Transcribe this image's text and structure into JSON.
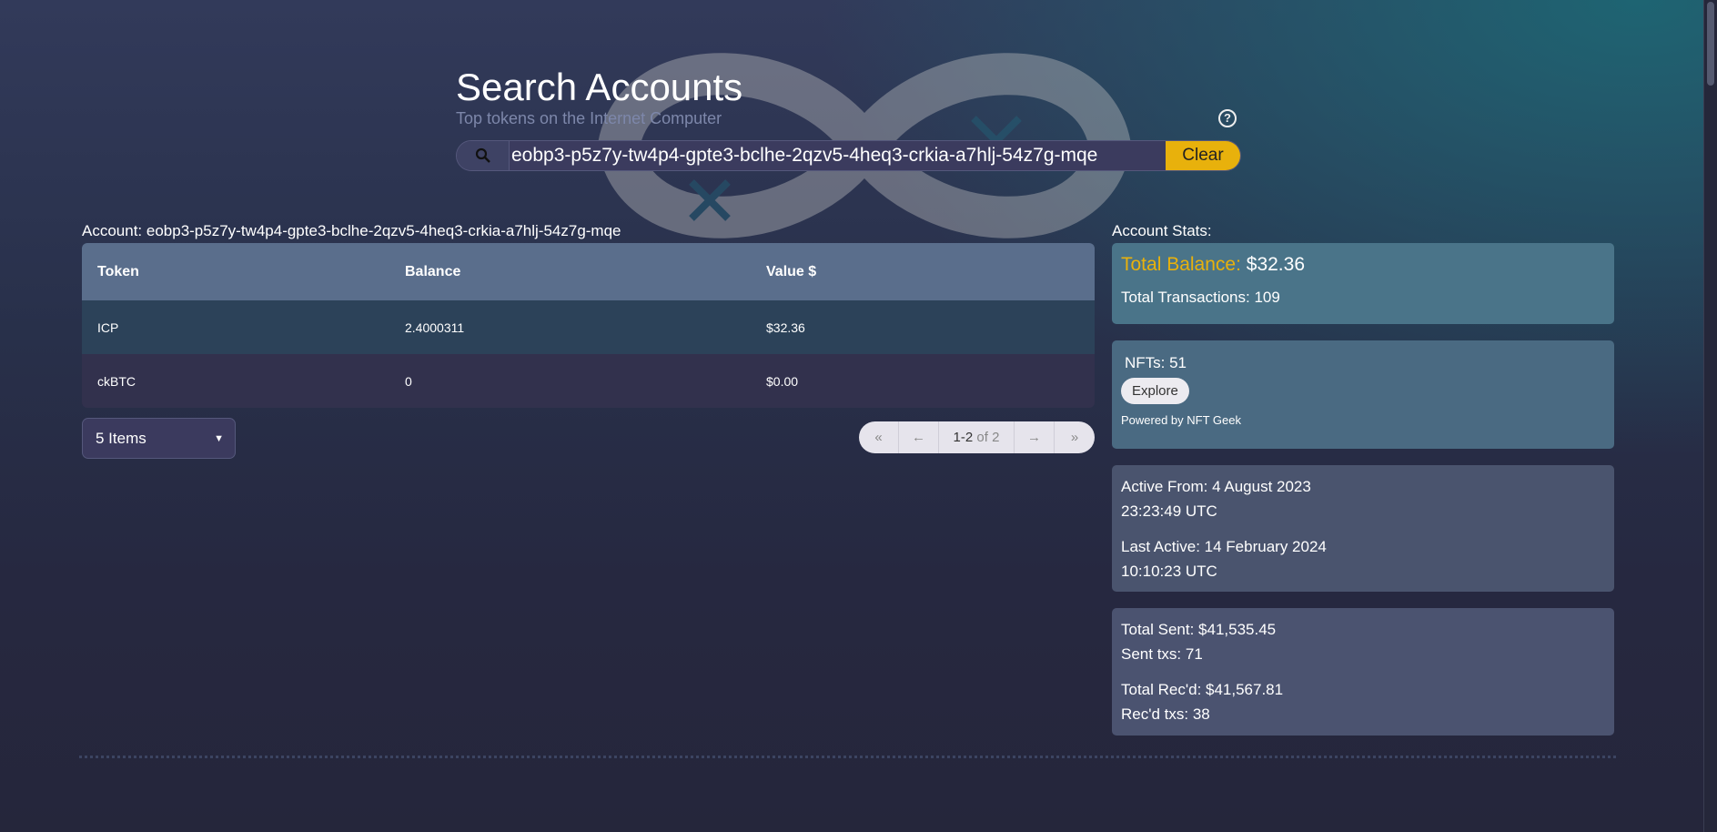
{
  "header": {
    "title": "Search Accounts",
    "subtitle": "Top tokens on the Internet Computer",
    "help_icon": "question-circle-icon"
  },
  "search": {
    "value": "eobp3-p5z7y-tw4p4-gpte3-bclhe-2qzv5-4heq3-crkia-a7hlj-54z7g-mqe",
    "clear_label": "Clear",
    "icon": "search-icon"
  },
  "account": {
    "label": "Account: eobp3-p5z7y-tw4p4-gpte3-bclhe-2qzv5-4heq3-crkia-a7hlj-54z7g-mqe"
  },
  "table": {
    "columns": [
      "Token",
      "Balance",
      "Value $"
    ],
    "rows": [
      [
        "ICP",
        "2.4000311",
        "$32.36"
      ],
      [
        "ckBTC",
        "0",
        "$0.00"
      ]
    ]
  },
  "page_size": {
    "selected": "5 Items"
  },
  "pagination": {
    "range": "1-2",
    "of": "of 2"
  },
  "stats": {
    "label": "Account Stats:",
    "total_balance_key": "Total Balance:",
    "total_balance_value": "$32.36",
    "total_transactions": "Total Transactions: 109",
    "nfts": "NFTs: 51",
    "explore_label": "Explore",
    "powered_by": "Powered by NFT Geek",
    "active_from": "Active From: 4 August 2023",
    "active_from_time": "23:23:49 UTC",
    "last_active": "Last Active: 14 February 2024",
    "last_active_time": "10:10:23 UTC",
    "total_sent": "Total Sent: $41,535.45",
    "sent_txs": "Sent txs: 71",
    "total_recd": "Total Rec'd: $41,567.81",
    "recd_txs": "Rec'd txs: 38"
  },
  "colors": {
    "accent": "#e8b10c",
    "header_row": "#5a6e8c"
  }
}
